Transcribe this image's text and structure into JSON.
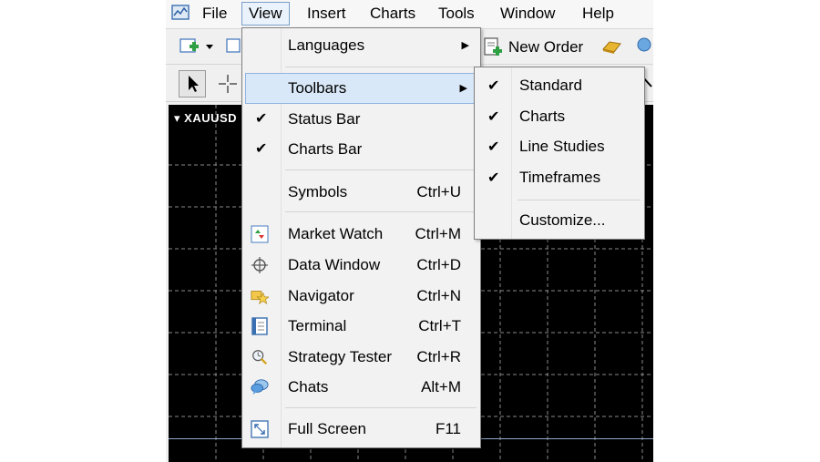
{
  "menubar": {
    "items": [
      {
        "label": "File"
      },
      {
        "label": "View"
      },
      {
        "label": "Insert"
      },
      {
        "label": "Charts"
      },
      {
        "label": "Tools"
      },
      {
        "label": "Window"
      },
      {
        "label": "Help"
      }
    ],
    "active": "View"
  },
  "toolbar": {
    "new_order_label": "New Order"
  },
  "chart": {
    "symbol": "XAUUSD",
    "background": "#000000",
    "grid_color": "#8a8a8a"
  },
  "view_menu": {
    "items": [
      {
        "label": "Languages",
        "submenu": true
      },
      {
        "label": "Toolbars",
        "submenu": true,
        "highlighted": true
      },
      {
        "label": "Status Bar",
        "checked": true
      },
      {
        "label": "Charts Bar",
        "checked": true
      },
      {
        "label": "Symbols",
        "shortcut": "Ctrl+U"
      },
      {
        "label": "Market Watch",
        "shortcut": "Ctrl+M",
        "icon": "market-watch-icon"
      },
      {
        "label": "Data Window",
        "shortcut": "Ctrl+D",
        "icon": "crosshair-icon"
      },
      {
        "label": "Navigator",
        "shortcut": "Ctrl+N",
        "icon": "navigator-star-icon"
      },
      {
        "label": "Terminal",
        "shortcut": "Ctrl+T",
        "icon": "terminal-icon"
      },
      {
        "label": "Strategy Tester",
        "shortcut": "Ctrl+R",
        "icon": "strategy-tester-icon"
      },
      {
        "label": "Chats",
        "shortcut": "Alt+M",
        "icon": "chat-bubbles-icon"
      },
      {
        "label": "Full Screen",
        "shortcut": "F11",
        "icon": "full-screen-icon"
      }
    ]
  },
  "toolbars_submenu": {
    "items": [
      {
        "label": "Standard",
        "checked": true
      },
      {
        "label": "Charts",
        "checked": true
      },
      {
        "label": "Line Studies",
        "checked": true
      },
      {
        "label": "Timeframes",
        "checked": true
      },
      {
        "label": "Customize..."
      }
    ]
  },
  "colors": {
    "highlight": "#d9e8f8",
    "highlight_border": "#8fb3de",
    "menu_bg": "#f2f2f2"
  }
}
